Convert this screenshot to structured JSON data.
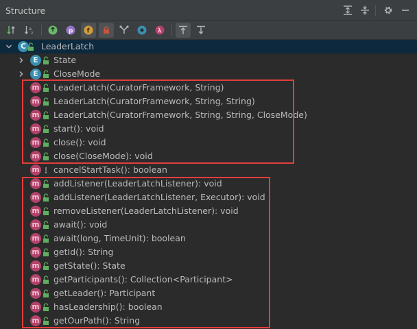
{
  "window": {
    "title": "Structure"
  },
  "colors": {
    "accent_red": "#e43d3d",
    "method_badge": "#b2426a",
    "class_badge": "#3a8fb0",
    "selected_row": "#0d293e"
  },
  "titlebar_icons": [
    "expand-all-icon",
    "collapse-all-icon",
    "gear-icon",
    "minimize-icon"
  ],
  "toolbar_icons": [
    "sort-by-visibility-icon",
    "sort-alphabetically-icon",
    "show-inherited-icon",
    "show-properties-icon",
    "show-fields-icon",
    "show-non-public-icon",
    "show-lambdas-tree-icon",
    "show-anonymous-icon",
    "show-lambdas-icon",
    "autoscroll-to-source-icon",
    "autoscroll-from-source-icon"
  ],
  "tree": {
    "root": {
      "badge": "C",
      "label": "LeaderLatch"
    },
    "nested": [
      {
        "badge": "E",
        "label": "State"
      },
      {
        "badge": "E",
        "label": "CloseMode"
      }
    ],
    "members": [
      {
        "badge": "m",
        "label": "LeaderLatch(CuratorFramework, String)",
        "visibility": "public"
      },
      {
        "badge": "m",
        "label": "LeaderLatch(CuratorFramework, String, String)",
        "visibility": "public"
      },
      {
        "badge": "m",
        "label": "LeaderLatch(CuratorFramework, String, String, CloseMode)",
        "visibility": "public"
      },
      {
        "badge": "m",
        "label": "start(): void",
        "visibility": "public"
      },
      {
        "badge": "m",
        "label": "close(): void",
        "visibility": "public"
      },
      {
        "badge": "m",
        "label": "close(CloseMode): void",
        "visibility": "public"
      },
      {
        "badge": "m",
        "label": "cancelStartTask(): boolean",
        "visibility": "package"
      },
      {
        "badge": "m",
        "label": "addListener(LeaderLatchListener): void",
        "visibility": "public"
      },
      {
        "badge": "m",
        "label": "addListener(LeaderLatchListener, Executor): void",
        "visibility": "public"
      },
      {
        "badge": "m",
        "label": "removeListener(LeaderLatchListener): void",
        "visibility": "public"
      },
      {
        "badge": "m",
        "label": "await(): void",
        "visibility": "public"
      },
      {
        "badge": "m",
        "label": "await(long, TimeUnit): boolean",
        "visibility": "public"
      },
      {
        "badge": "m",
        "label": "getId(): String",
        "visibility": "public"
      },
      {
        "badge": "m",
        "label": "getState(): State",
        "visibility": "public"
      },
      {
        "badge": "m",
        "label": "getParticipants(): Collection<Participant>",
        "visibility": "public"
      },
      {
        "badge": "m",
        "label": "getLeader(): Participant",
        "visibility": "public"
      },
      {
        "badge": "m",
        "label": "hasLeadership(): boolean",
        "visibility": "public"
      },
      {
        "badge": "m",
        "label": "getOurPath(): String",
        "visibility": "public"
      }
    ]
  }
}
